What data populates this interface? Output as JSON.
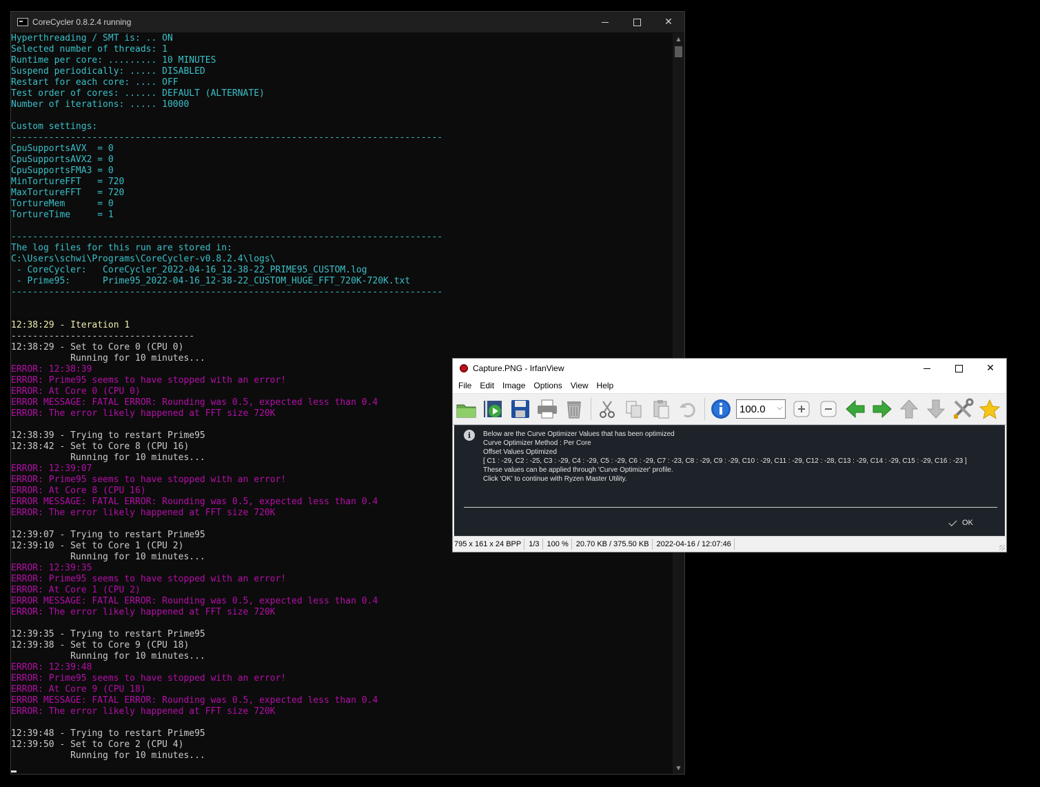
{
  "console": {
    "title": "CoreCycler 0.8.2.4 running",
    "lines": [
      {
        "t": "Hyperthreading / SMT is: .. ON",
        "c": "cyan"
      },
      {
        "t": "Selected number of threads: 1",
        "c": "cyan"
      },
      {
        "t": "Runtime per core: ......... 10 MINUTES",
        "c": "cyan"
      },
      {
        "t": "Suspend periodically: ..... DISABLED",
        "c": "cyan"
      },
      {
        "t": "Restart for each core: .... OFF",
        "c": "cyan"
      },
      {
        "t": "Test order of cores: ...... DEFAULT (ALTERNATE)",
        "c": "cyan"
      },
      {
        "t": "Number of iterations: ..... 10000",
        "c": "cyan"
      },
      {
        "t": "",
        "c": "cyan"
      },
      {
        "t": "Custom settings:",
        "c": "cyan"
      },
      {
        "t": "--------------------------------------------------------------------------------",
        "c": "cyan"
      },
      {
        "t": "CpuSupportsAVX  = 0",
        "c": "cyan"
      },
      {
        "t": "CpuSupportsAVX2 = 0",
        "c": "cyan"
      },
      {
        "t": "CpuSupportsFMA3 = 0",
        "c": "cyan"
      },
      {
        "t": "MinTortureFFT   = 720",
        "c": "cyan"
      },
      {
        "t": "MaxTortureFFT   = 720",
        "c": "cyan"
      },
      {
        "t": "TortureMem      = 0",
        "c": "cyan"
      },
      {
        "t": "TortureTime     = 1",
        "c": "cyan"
      },
      {
        "t": "",
        "c": "cyan"
      },
      {
        "t": "--------------------------------------------------------------------------------",
        "c": "cyan"
      },
      {
        "t": "The log files for this run are stored in:",
        "c": "cyan"
      },
      {
        "t": "C:\\Users\\schwi\\Programs\\CoreCycler-v0.8.2.4\\logs\\",
        "c": "cyan"
      },
      {
        "t": " - CoreCycler:   CoreCycler_2022-04-16_12-38-22_PRIME95_CUSTOM.log",
        "c": "cyan"
      },
      {
        "t": " - Prime95:      Prime95_2022-04-16_12-38-22_CUSTOM_HUGE_FFT_720K-720K.txt",
        "c": "cyan"
      },
      {
        "t": "--------------------------------------------------------------------------------",
        "c": "cyan"
      },
      {
        "t": "",
        "c": "cyan"
      },
      {
        "t": "",
        "c": "cyan"
      },
      {
        "t": "12:38:29 - Iteration 1",
        "c": "yellow"
      },
      {
        "t": "----------------------------------",
        "c": "white"
      },
      {
        "t": "12:38:29 - Set to Core 0 (CPU 0)",
        "c": "white"
      },
      {
        "t": "           Running for 10 minutes...",
        "c": "white"
      },
      {
        "t": "ERROR: 12:38:39",
        "c": "mag"
      },
      {
        "t": "ERROR: Prime95 seems to have stopped with an error!",
        "c": "mag"
      },
      {
        "t": "ERROR: At Core 0 (CPU 0)",
        "c": "mag"
      },
      {
        "t": "ERROR MESSAGE: FATAL ERROR: Rounding was 0.5, expected less than 0.4",
        "c": "mag"
      },
      {
        "t": "ERROR: The error likely happened at FFT size 720K",
        "c": "mag"
      },
      {
        "t": "",
        "c": "white"
      },
      {
        "t": "12:38:39 - Trying to restart Prime95",
        "c": "white"
      },
      {
        "t": "12:38:42 - Set to Core 8 (CPU 16)",
        "c": "white"
      },
      {
        "t": "           Running for 10 minutes...",
        "c": "white"
      },
      {
        "t": "ERROR: 12:39:07",
        "c": "mag"
      },
      {
        "t": "ERROR: Prime95 seems to have stopped with an error!",
        "c": "mag"
      },
      {
        "t": "ERROR: At Core 8 (CPU 16)",
        "c": "mag"
      },
      {
        "t": "ERROR MESSAGE: FATAL ERROR: Rounding was 0.5, expected less than 0.4",
        "c": "mag"
      },
      {
        "t": "ERROR: The error likely happened at FFT size 720K",
        "c": "mag"
      },
      {
        "t": "",
        "c": "white"
      },
      {
        "t": "12:39:07 - Trying to restart Prime95",
        "c": "white"
      },
      {
        "t": "12:39:10 - Set to Core 1 (CPU 2)",
        "c": "white"
      },
      {
        "t": "           Running for 10 minutes...",
        "c": "white"
      },
      {
        "t": "ERROR: 12:39:35",
        "c": "mag"
      },
      {
        "t": "ERROR: Prime95 seems to have stopped with an error!",
        "c": "mag"
      },
      {
        "t": "ERROR: At Core 1 (CPU 2)",
        "c": "mag"
      },
      {
        "t": "ERROR MESSAGE: FATAL ERROR: Rounding was 0.5, expected less than 0.4",
        "c": "mag"
      },
      {
        "t": "ERROR: The error likely happened at FFT size 720K",
        "c": "mag"
      },
      {
        "t": "",
        "c": "white"
      },
      {
        "t": "12:39:35 - Trying to restart Prime95",
        "c": "white"
      },
      {
        "t": "12:39:38 - Set to Core 9 (CPU 18)",
        "c": "white"
      },
      {
        "t": "           Running for 10 minutes...",
        "c": "white"
      },
      {
        "t": "ERROR: 12:39:48",
        "c": "mag"
      },
      {
        "t": "ERROR: Prime95 seems to have stopped with an error!",
        "c": "mag"
      },
      {
        "t": "ERROR: At Core 9 (CPU 18)",
        "c": "mag"
      },
      {
        "t": "ERROR MESSAGE: FATAL ERROR: Rounding was 0.5, expected less than 0.4",
        "c": "mag"
      },
      {
        "t": "ERROR: The error likely happened at FFT size 720K",
        "c": "mag"
      },
      {
        "t": "",
        "c": "white"
      },
      {
        "t": "12:39:48 - Trying to restart Prime95",
        "c": "white"
      },
      {
        "t": "12:39:50 - Set to Core 2 (CPU 4)",
        "c": "white"
      },
      {
        "t": "           Running for 10 minutes...",
        "c": "white"
      }
    ]
  },
  "irfan": {
    "title": "Capture.PNG - IrfanView",
    "menu": [
      "File",
      "Edit",
      "Image",
      "Options",
      "View",
      "Help"
    ],
    "zoom_value": "100.0",
    "message_lines": [
      "Below are the Curve Optimizer Values that has been optimized",
      "Curve Optimizer Method : Per Core",
      "Offset Values Optimized",
      "[ C1 : -29, C2 : -25, C3 : -29, C4 : -29, C5 : -29, C6 : -29, C7 : -23, C8 : -29, C9 : -29, C10 : -29, C11 : -29, C12 : -28, C13 : -29, C14 : -29, C15 : -29, C16 : -23 ]",
      "These values can be applied through 'Curve Optimizer' profile.",
      "Click 'OK' to continue with Ryzen Master Utility."
    ],
    "ok_label": "OK",
    "status": [
      "795 x 161 x 24 BPP",
      "1/3",
      "100 %",
      "20.70 KB / 375.50 KB",
      "2022-04-16 / 12:07:46"
    ]
  },
  "colors": {
    "console_cyan": "#3ac0c8",
    "console_magenta": "#b40ea8",
    "console_yellow": "#f0ecb0",
    "toolbar_arrow_green": "#3aa83a"
  }
}
